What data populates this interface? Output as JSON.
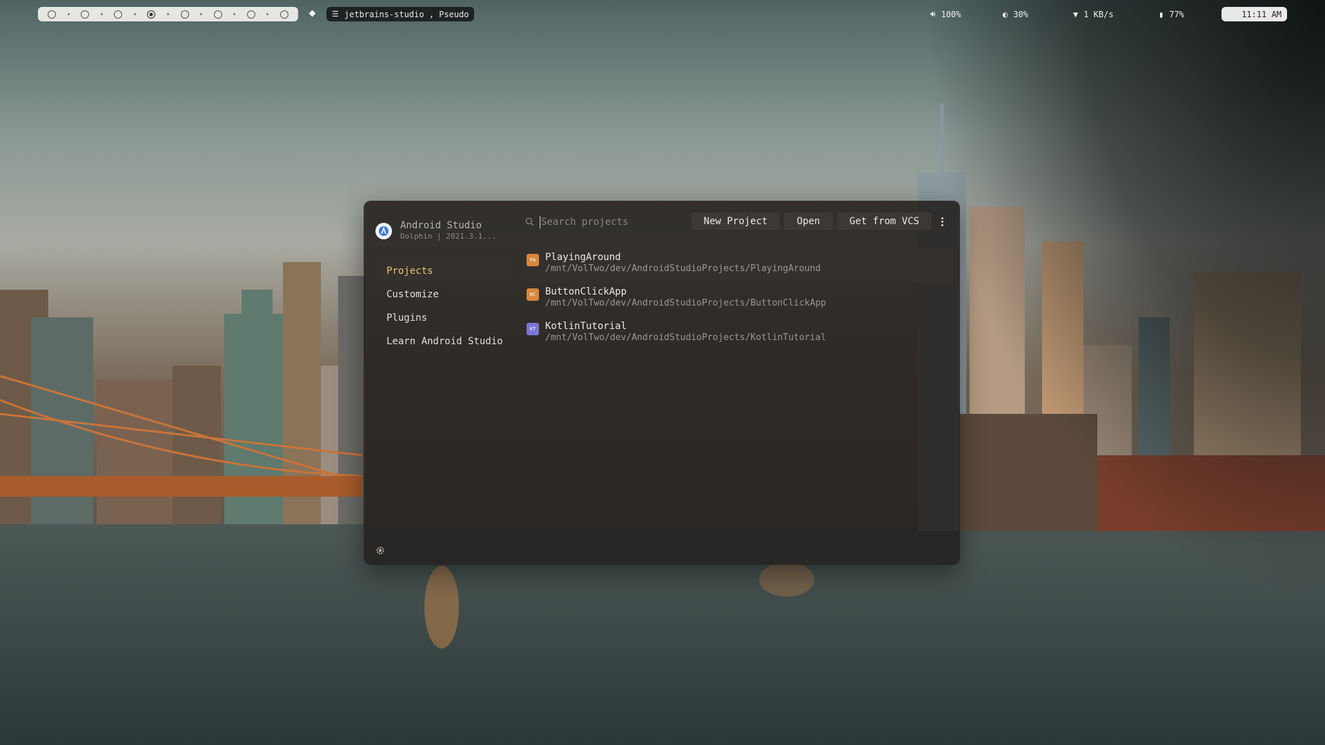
{
  "topbar": {
    "workspaces": [
      "ws1",
      "ws2",
      "ws3",
      "ws4",
      "ws5",
      "ws6",
      "ws7",
      "ws8"
    ],
    "active_workspace_index": 3,
    "window_title": "jetbrains-studio , Pseudo",
    "volume": "100%",
    "brightness": "30%",
    "network": "1 KB/s",
    "battery": "77%",
    "clock": "11:11 AM"
  },
  "dialog": {
    "app_name": "Android Studio",
    "app_version": "Dolphin | 2021.3.1...",
    "nav": [
      {
        "label": "Projects",
        "active": true
      },
      {
        "label": "Customize",
        "active": false
      },
      {
        "label": "Plugins",
        "active": false
      },
      {
        "label": "Learn Android Studio",
        "active": false
      }
    ],
    "search": {
      "placeholder": "Search projects",
      "value": ""
    },
    "buttons": {
      "new_project": "New Project",
      "open": "Open",
      "get_from_vcs": "Get from VCS"
    },
    "projects": [
      {
        "badge": "PA",
        "badge_color": "#d9863b",
        "name": "PlayingAround",
        "path": "/mnt/VolTwo/dev/AndroidStudioProjects/PlayingAround",
        "selected": true
      },
      {
        "badge": "BC",
        "badge_color": "#d9863b",
        "name": "ButtonClickApp",
        "path": "/mnt/VolTwo/dev/AndroidStudioProjects/ButtonClickApp",
        "selected": false
      },
      {
        "badge": "KT",
        "badge_color": "#7b74d6",
        "name": "KotlinTutorial",
        "path": "/mnt/VolTwo/dev/AndroidStudioProjects/KotlinTutorial",
        "selected": false
      }
    ]
  },
  "colors": {
    "accent": "#e8c46c",
    "dialog_bg": "#262220"
  }
}
